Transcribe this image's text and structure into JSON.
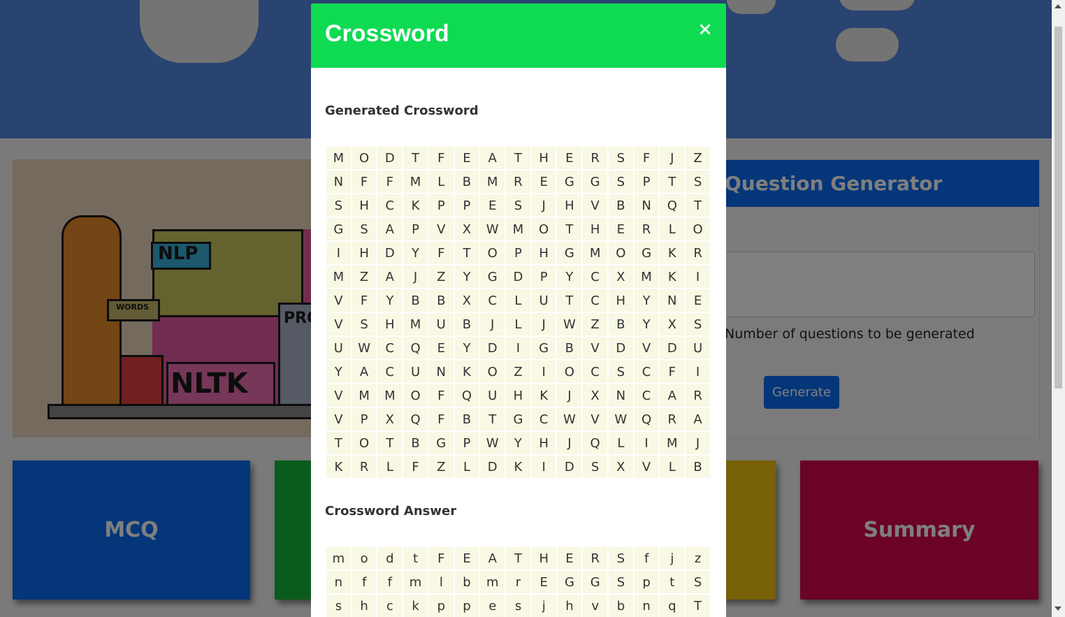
{
  "background": {
    "generator_title": "Question Generator",
    "generator_field_label": "Number of questions to be generated",
    "generate_button": "Generate",
    "tiles": {
      "mcq": "MCQ",
      "summary": "Summary"
    },
    "illustration": {
      "label_nlp": "NLP",
      "label_words": "WORDS",
      "label_nltk": "NLTK",
      "label_prog": "PROG"
    }
  },
  "modal": {
    "title": "Crossword",
    "close_icon": "×",
    "crossword_title": "Generated Crossword",
    "answer_title": "Crossword Answer",
    "crossword_grid": [
      [
        "M",
        "O",
        "D",
        "T",
        "F",
        "E",
        "A",
        "T",
        "H",
        "E",
        "R",
        "S",
        "F",
        "J",
        "Z"
      ],
      [
        "N",
        "F",
        "F",
        "M",
        "L",
        "B",
        "M",
        "R",
        "E",
        "G",
        "G",
        "S",
        "P",
        "T",
        "S"
      ],
      [
        "S",
        "H",
        "C",
        "K",
        "P",
        "P",
        "E",
        "S",
        "J",
        "H",
        "V",
        "B",
        "N",
        "Q",
        "T"
      ],
      [
        "G",
        "S",
        "A",
        "P",
        "V",
        "X",
        "W",
        "M",
        "O",
        "T",
        "H",
        "E",
        "R",
        "L",
        "O"
      ],
      [
        "I",
        "H",
        "D",
        "Y",
        "F",
        "T",
        "O",
        "P",
        "H",
        "G",
        "M",
        "O",
        "G",
        "K",
        "R"
      ],
      [
        "M",
        "Z",
        "A",
        "J",
        "Z",
        "Y",
        "G",
        "D",
        "P",
        "Y",
        "C",
        "X",
        "M",
        "K",
        "I"
      ],
      [
        "V",
        "F",
        "Y",
        "B",
        "B",
        "X",
        "C",
        "L",
        "U",
        "T",
        "C",
        "H",
        "Y",
        "N",
        "E"
      ],
      [
        "V",
        "S",
        "H",
        "M",
        "U",
        "B",
        "J",
        "L",
        "J",
        "W",
        "Z",
        "B",
        "Y",
        "X",
        "S"
      ],
      [
        "U",
        "W",
        "C",
        "Q",
        "E",
        "Y",
        "D",
        "I",
        "G",
        "B",
        "V",
        "D",
        "V",
        "D",
        "U"
      ],
      [
        "Y",
        "A",
        "C",
        "U",
        "N",
        "K",
        "O",
        "Z",
        "I",
        "O",
        "C",
        "S",
        "C",
        "F",
        "I"
      ],
      [
        "V",
        "M",
        "M",
        "O",
        "F",
        "Q",
        "U",
        "H",
        "K",
        "J",
        "X",
        "N",
        "C",
        "A",
        "R"
      ],
      [
        "V",
        "P",
        "X",
        "Q",
        "F",
        "B",
        "T",
        "G",
        "C",
        "W",
        "V",
        "W",
        "Q",
        "R",
        "A"
      ],
      [
        "T",
        "O",
        "T",
        "B",
        "G",
        "P",
        "W",
        "Y",
        "H",
        "J",
        "Q",
        "L",
        "I",
        "M",
        "J"
      ],
      [
        "K",
        "R",
        "L",
        "F",
        "Z",
        "L",
        "D",
        "K",
        "I",
        "D",
        "S",
        "X",
        "V",
        "L",
        "B"
      ]
    ],
    "answer_grid": [
      [
        "m",
        "o",
        "d",
        "t",
        "F",
        "E",
        "A",
        "T",
        "H",
        "E",
        "R",
        "S",
        "f",
        "j",
        "z"
      ],
      [
        "n",
        "f",
        "f",
        "m",
        "l",
        "b",
        "m",
        "r",
        "E",
        "G",
        "G",
        "S",
        "p",
        "t",
        "S"
      ],
      [
        "s",
        "h",
        "c",
        "k",
        "p",
        "p",
        "e",
        "s",
        "j",
        "h",
        "v",
        "b",
        "n",
        "q",
        "T"
      ]
    ]
  },
  "colors": {
    "modal_header": "#0edb52",
    "cell_bg": "#f8f8e4",
    "primary": "#0a6cf5",
    "summary": "#d4064a"
  }
}
